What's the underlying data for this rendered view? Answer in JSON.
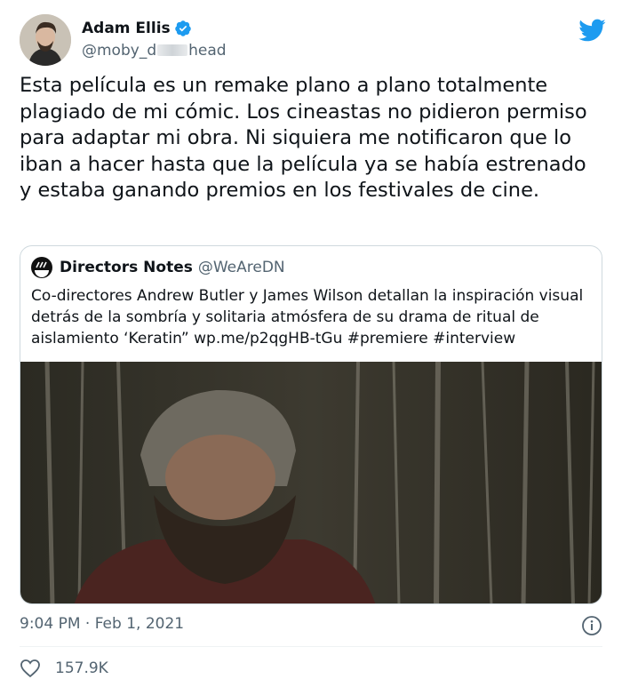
{
  "author": {
    "name": "Adam Ellis",
    "handle": "@moby_d",
    "handle_suffix": "head",
    "verified": true,
    "avatar_icon": "avatar-photo"
  },
  "tweet": {
    "text": "Esta película es un remake plano a plano totalmente plagiado de mi cómic. Los cineastas no pidieron permiso para adaptar mi obra. Ni siquiera me notificaron que lo iban a hacer hasta que la película ya se había estrenado y estaba ganando premios en los festivales de cine."
  },
  "quoted": {
    "name": "Directors Notes",
    "handle": "@WeAreDN",
    "text": "Co-directores Andrew Butler y James Wilson detallan la inspiración visual detrás de la sombría y solitaria atmósfera de su drama de ritual de aislamiento ‘Keratin” wp.me/p2qgHB-tGu #premiere #interview"
  },
  "meta": {
    "timestamp": "9:04 PM · Feb 1, 2021",
    "like_count": "157.9K"
  },
  "colors": {
    "twitter_blue": "#1d9bf0",
    "muted_text": "#536471",
    "border": "#cfd9de"
  }
}
